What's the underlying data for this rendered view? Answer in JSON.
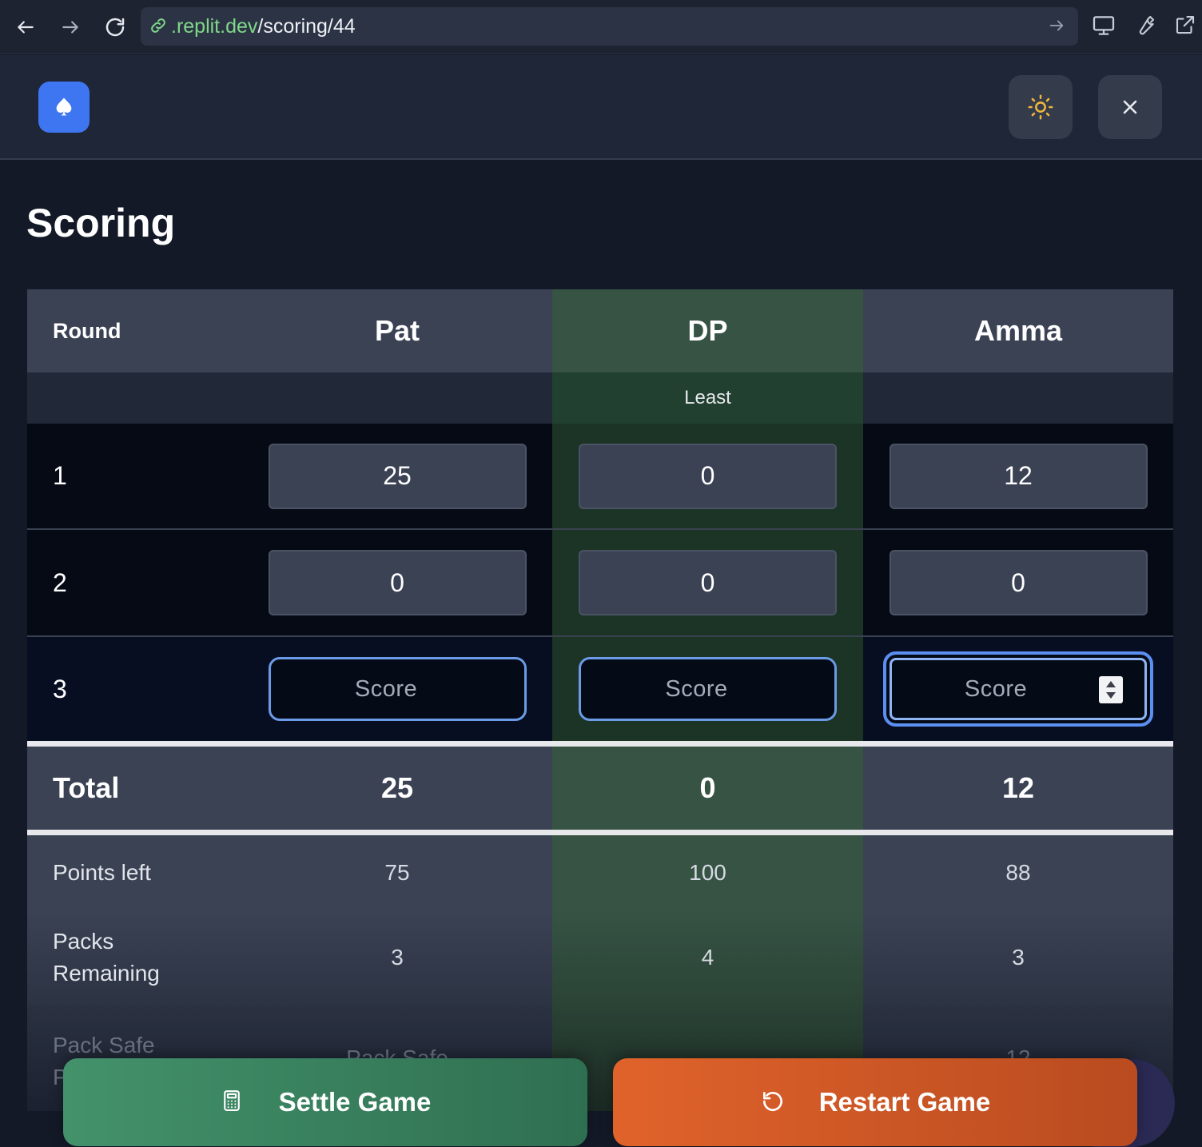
{
  "browser": {
    "url_domain": ".replit.dev",
    "url_path": "/scoring/44"
  },
  "header": {
    "logo_icon": "spade-icon",
    "theme_icon": "sun-icon",
    "close_icon": "close-icon"
  },
  "page": {
    "title": "Scoring"
  },
  "table": {
    "round_label": "Round",
    "players": [
      "Pat",
      "DP",
      "Amma"
    ],
    "highlight_label": "Least",
    "rounds": [
      {
        "round": "1",
        "scores": [
          "25",
          "0",
          "12"
        ]
      },
      {
        "round": "2",
        "scores": [
          "0",
          "0",
          "0"
        ]
      },
      {
        "round": "3",
        "placeholder": "Score"
      }
    ],
    "total_label": "Total",
    "totals": [
      "25",
      "0",
      "12"
    ],
    "points_left_label": "Points left",
    "points_left": [
      "75",
      "100",
      "88"
    ],
    "packs_label_1": "Packs",
    "packs_label_2": "Remaining",
    "packs": [
      "3",
      "4",
      "3"
    ],
    "pack_safe_label_1": "Pack Safe",
    "pack_safe_label_2": "P",
    "pack_safe_pat": "Pack Safe",
    "pack_safe_amma": "12"
  },
  "actions": {
    "settle_label": "Settle Game",
    "restart_label": "Restart Game"
  },
  "colors": {
    "accent": "#3e76f1",
    "highlight_column": "#365344",
    "settle": "#43926b",
    "restart": "#e0632b",
    "input_border": "#6b9be6"
  }
}
